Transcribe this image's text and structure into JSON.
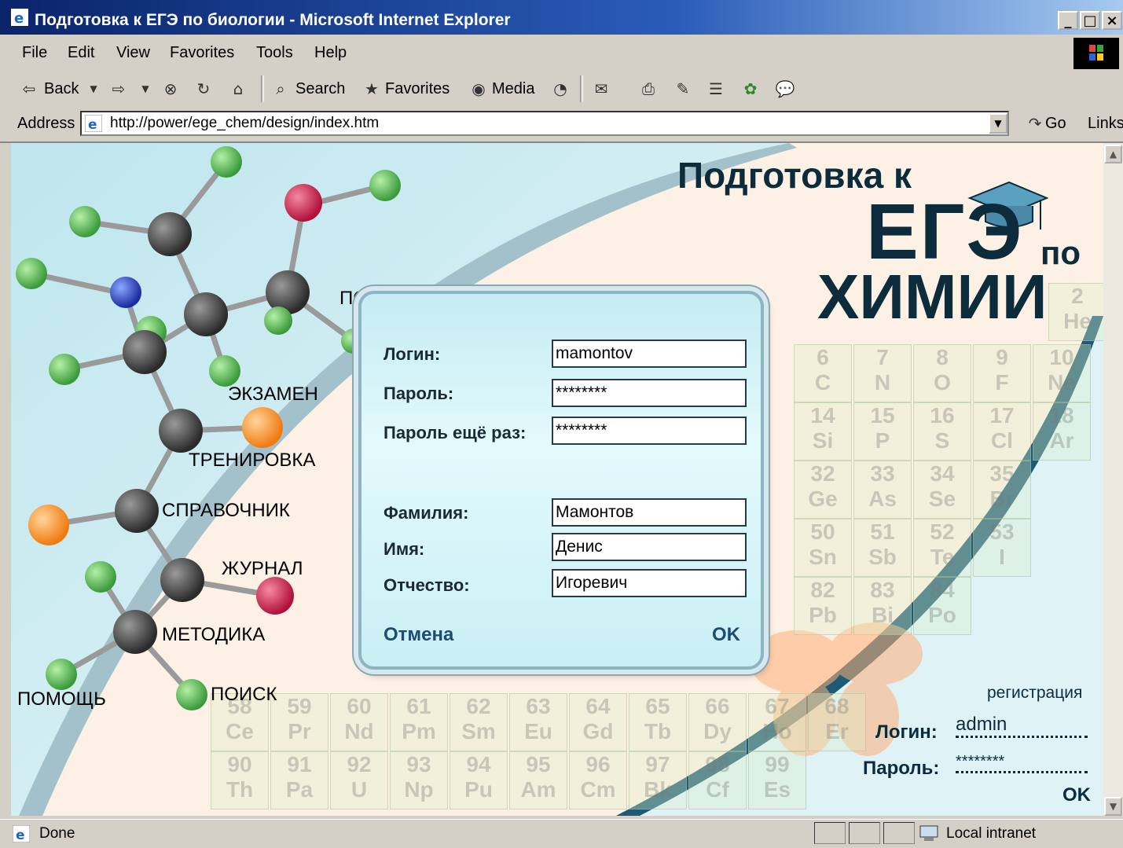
{
  "window": {
    "title": "Подготовка к ЕГЭ по биологии - Microsoft Internet Explorer",
    "minimize": "_",
    "maximize": "□",
    "close": "×"
  },
  "menu": [
    "File",
    "Edit",
    "View",
    "Favorites",
    "Tools",
    "Help"
  ],
  "toolbar": {
    "back": "Back",
    "search": "Search",
    "favorites": "Favorites",
    "media": "Media"
  },
  "address": {
    "label": "Address",
    "url": "http://power/ege_chem/design/index.htm",
    "go": "Go",
    "links": "Links"
  },
  "page": {
    "title_line1": "Подготовка к",
    "title_line2": "ЕГЭ",
    "title_po": "по",
    "title_line3": "ХИМИИ",
    "nav": {
      "podgotovka": "ПОДГОТОВКА",
      "ekzamen": "ЭКЗАМЕН",
      "trenirovka": "ТРЕНИРОВКА",
      "spravochnik": "СПРАВОЧНИК",
      "zhurnal": "ЖУРНАЛ",
      "metodika": "МЕТОДИКА",
      "pomosch": "ПОМОЩЬ",
      "poisk": "ПОИСК"
    },
    "periodic_cells": [
      [
        "2",
        "He"
      ],
      [
        "6",
        "C"
      ],
      [
        "7",
        "N"
      ],
      [
        "8",
        "O"
      ],
      [
        "9",
        "F"
      ],
      [
        "10",
        "Ne"
      ],
      [
        "14",
        "Si"
      ],
      [
        "15",
        "P"
      ],
      [
        "16",
        "S"
      ],
      [
        "17",
        "Cl"
      ],
      [
        "18",
        "Ar"
      ],
      [
        "32",
        "Ge"
      ],
      [
        "33",
        "As"
      ],
      [
        "34",
        "Se"
      ],
      [
        "35",
        "Br"
      ],
      [
        "50",
        "Sn"
      ],
      [
        "51",
        "Sb"
      ],
      [
        "52",
        "Te"
      ],
      [
        "53",
        "I"
      ],
      [
        "82",
        "Pb"
      ],
      [
        "83",
        "Bi"
      ],
      [
        "84",
        "Po"
      ],
      [
        "58",
        "Ce"
      ],
      [
        "59",
        "Pr"
      ],
      [
        "60",
        "Nd"
      ],
      [
        "61",
        "Pm"
      ],
      [
        "62",
        "Sm"
      ],
      [
        "63",
        "Eu"
      ],
      [
        "64",
        "Gd"
      ],
      [
        "65",
        "Tb"
      ],
      [
        "66",
        "Dy"
      ],
      [
        "67",
        "Ho"
      ],
      [
        "68",
        "Er"
      ],
      [
        "90",
        "Th"
      ],
      [
        "91",
        "Pa"
      ],
      [
        "92",
        "U"
      ],
      [
        "93",
        "Np"
      ],
      [
        "94",
        "Pu"
      ],
      [
        "95",
        "Am"
      ],
      [
        "96",
        "Cm"
      ],
      [
        "97",
        "Bk"
      ],
      [
        "98",
        "Cf"
      ],
      [
        "99",
        "Es"
      ]
    ],
    "corner_login": {
      "register": "регистрация",
      "login_label": "Логин:",
      "login_value": "admin",
      "password_label": "Пароль:",
      "password_value": "********",
      "ok": "OK"
    }
  },
  "dialog": {
    "login_label": "Логин:",
    "login_value": "mamontov",
    "password_label": "Пароль:",
    "password_value": "********",
    "password2_label": "Пароль ещё раз:",
    "password2_value": "********",
    "surname_label": "Фамилия:",
    "surname_value": "Мамонтов",
    "name_label": "Имя:",
    "name_value": "Денис",
    "patronymic_label": "Отчество:",
    "patronymic_value": "Игоревич",
    "cancel": "Отмена",
    "ok": "OK"
  },
  "status": {
    "text": "Done",
    "zone": "Local intranet"
  }
}
